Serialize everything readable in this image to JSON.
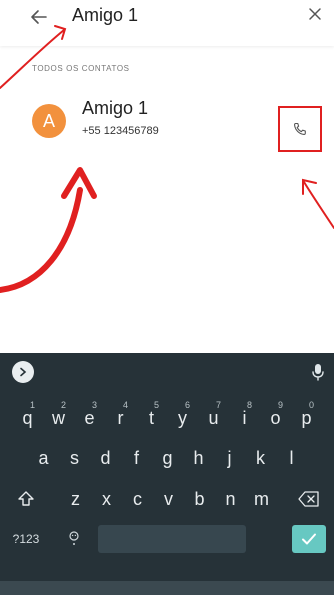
{
  "search": {
    "query": "Amigo 1"
  },
  "section_label": "TODOS OS CONTATOS",
  "contact": {
    "initial": "A",
    "name": "Amigo 1",
    "phone": "+55 123456789"
  },
  "keyboard": {
    "row1": [
      {
        "k": "q",
        "s": "1"
      },
      {
        "k": "w",
        "s": "2"
      },
      {
        "k": "e",
        "s": "3"
      },
      {
        "k": "r",
        "s": "4"
      },
      {
        "k": "t",
        "s": "5"
      },
      {
        "k": "y",
        "s": "6"
      },
      {
        "k": "u",
        "s": "7"
      },
      {
        "k": "i",
        "s": "8"
      },
      {
        "k": "o",
        "s": "9"
      },
      {
        "k": "p",
        "s": "0"
      }
    ],
    "row2": [
      "a",
      "s",
      "d",
      "f",
      "g",
      "h",
      "j",
      "k",
      "l"
    ],
    "row3": [
      "z",
      "x",
      "c",
      "v",
      "b",
      "n",
      "m"
    ],
    "symbols_label": "?123"
  },
  "colors": {
    "avatar": "#f2913d",
    "annotation": "#e02020",
    "keyboard_bg": "#263238",
    "enter": "#67c8c2"
  }
}
